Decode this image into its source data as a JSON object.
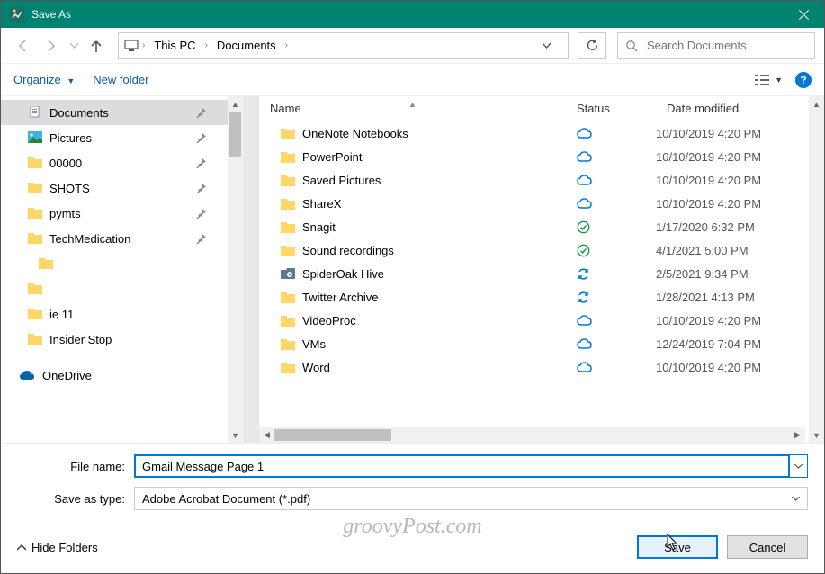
{
  "title": "Save As",
  "breadcrumbs": [
    "This PC",
    "Documents"
  ],
  "search_placeholder": "Search Documents",
  "toolbar": {
    "organize": "Organize",
    "new_folder": "New folder"
  },
  "sidebar": {
    "items": [
      {
        "label": "Documents",
        "icon": "doc",
        "pinned": true,
        "active": true
      },
      {
        "label": "Pictures",
        "icon": "pic",
        "pinned": true
      },
      {
        "label": "00000",
        "icon": "folder",
        "pinned": true
      },
      {
        "label": "SHOTS",
        "icon": "folder",
        "pinned": true
      },
      {
        "label": "pymts",
        "icon": "folder",
        "pinned": true
      },
      {
        "label": "TechMedication",
        "icon": "folder",
        "pinned": true
      },
      {
        "label": "",
        "icon": "folder",
        "pinned": false,
        "indent": true
      },
      {
        "label": "",
        "icon": "folder",
        "pinned": false
      },
      {
        "label": "ie 11",
        "icon": "folder",
        "pinned": false
      },
      {
        "label": "Insider Stop",
        "icon": "folder",
        "pinned": false
      }
    ],
    "onedrive": "OneDrive"
  },
  "columns": {
    "name": "Name",
    "status": "Status",
    "date": "Date modified"
  },
  "rows": [
    {
      "name": "OneNote Notebooks",
      "status": "cloud",
      "date": "10/10/2019 4:20 PM"
    },
    {
      "name": "PowerPoint",
      "status": "cloud",
      "date": "10/10/2019 4:20 PM"
    },
    {
      "name": "Saved Pictures",
      "status": "cloud",
      "date": "10/10/2019 4:20 PM"
    },
    {
      "name": "ShareX",
      "status": "cloud",
      "date": "10/10/2019 4:20 PM"
    },
    {
      "name": "Snagit",
      "status": "check",
      "date": "1/17/2020 6:32 PM"
    },
    {
      "name": "Sound recordings",
      "status": "check",
      "date": "4/1/2021 5:00 PM"
    },
    {
      "name": "SpiderOak Hive",
      "status": "sync",
      "date": "2/5/2021 9:34 PM",
      "icon": "special"
    },
    {
      "name": "Twitter Archive",
      "status": "sync",
      "date": "1/28/2021 4:13 PM"
    },
    {
      "name": "VideoProc",
      "status": "cloud",
      "date": "10/10/2019 4:20 PM"
    },
    {
      "name": "VMs",
      "status": "cloud",
      "date": "12/24/2019 7:04 PM"
    },
    {
      "name": "Word",
      "status": "cloud",
      "date": "10/10/2019 4:20 PM"
    }
  ],
  "form": {
    "file_name_label": "File name:",
    "file_name_value": "Gmail Message Page 1",
    "save_as_type_label": "Save as type:",
    "save_as_type_value": "Adobe Acrobat Document (*.pdf)"
  },
  "footer": {
    "hide_folders": "Hide Folders",
    "save": "Save",
    "cancel": "Cancel"
  },
  "watermark": "groovyPost.com"
}
